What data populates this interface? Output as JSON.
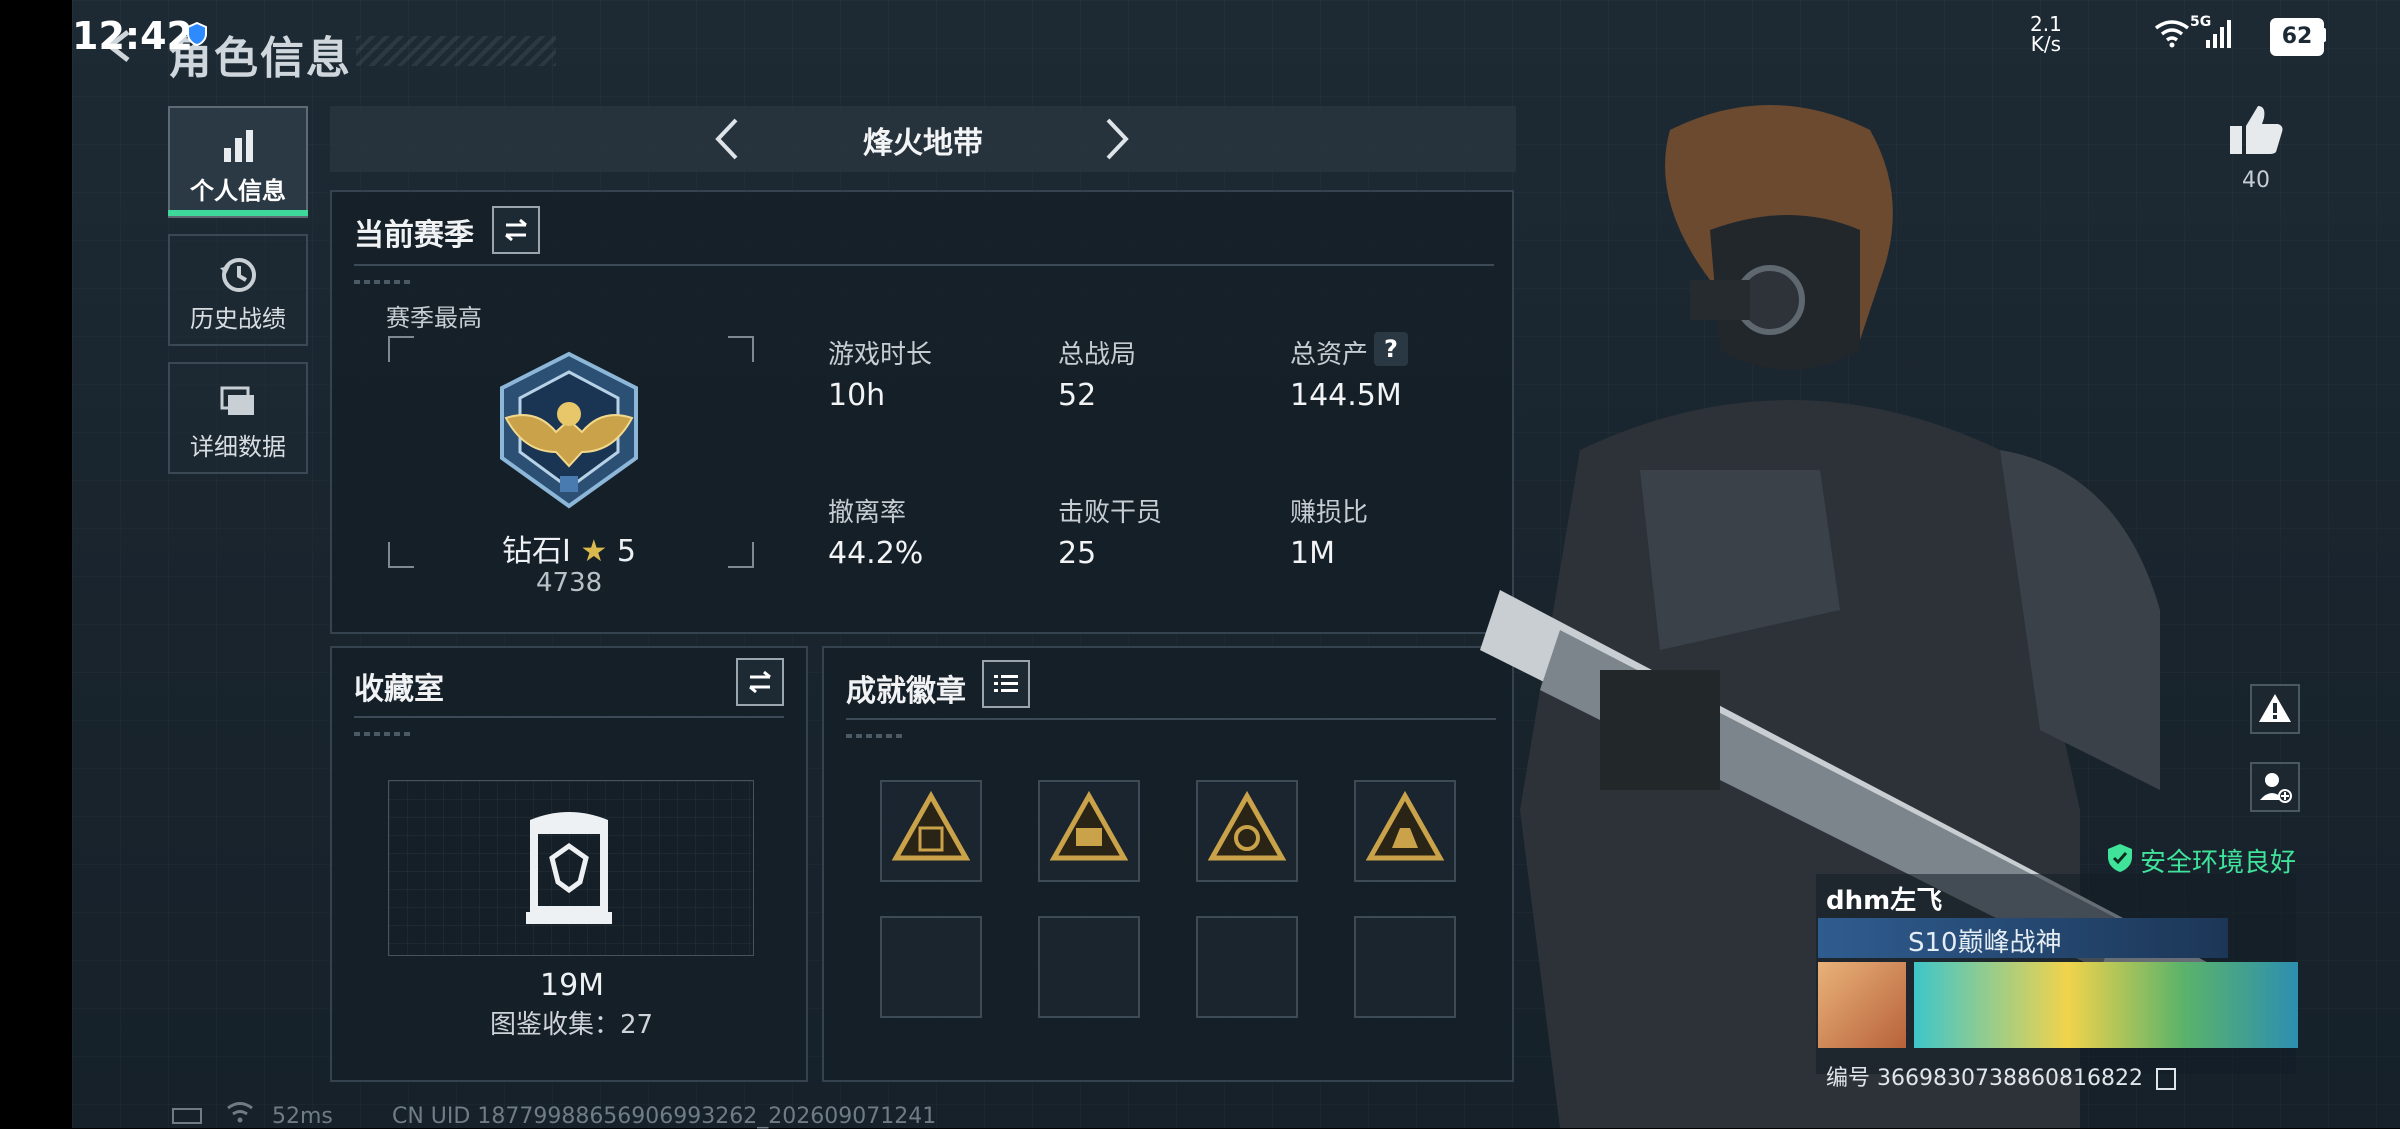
{
  "status_bar": {
    "time": "12:42",
    "net_speed_top": "2.1",
    "net_speed_bottom": "K/s",
    "network": "5G",
    "battery": "62"
  },
  "header": {
    "title": "角色信息"
  },
  "sidebar": {
    "items": [
      {
        "label": "个人信息",
        "icon": "bar-chart-icon",
        "active": true
      },
      {
        "label": "历史战绩",
        "icon": "history-clock-icon",
        "active": false
      },
      {
        "label": "详细数据",
        "icon": "folders-icon",
        "active": false
      }
    ]
  },
  "mode": {
    "title": "烽火地带"
  },
  "season": {
    "title": "当前赛季",
    "season_best_label": "赛季最高",
    "rank_name": "钻石Ⅰ",
    "rank_stars": "5",
    "rank_score": "4738",
    "stats": [
      {
        "label": "游戏时长",
        "value": "10h"
      },
      {
        "label": "总战局",
        "value": "52"
      },
      {
        "label": "总资产",
        "value": "144.5M"
      },
      {
        "label": "撤离率",
        "value": "44.2%"
      },
      {
        "label": "击败干员",
        "value": "25"
      },
      {
        "label": "赚损比",
        "value": "1M"
      }
    ],
    "help_glyph": "?"
  },
  "collection": {
    "title": "收藏室",
    "value": "19M",
    "catalog_label": "图鉴收集：27"
  },
  "achievements": {
    "title": "成就徽章",
    "filled_slots": 4,
    "empty_slots": 4
  },
  "player": {
    "likes": "40",
    "name": "dhm左飞",
    "title": "S10巅峰战神",
    "id_label": "编号 3669830738860816822",
    "env_status": "安全环境良好"
  },
  "footer": {
    "ping": "52ms",
    "uid": "CN UID 18779988656906993262_202609071241"
  },
  "colors": {
    "accent_green": "#3dd89a",
    "gold": "#c9a24a",
    "panel_border": "#34434f"
  }
}
